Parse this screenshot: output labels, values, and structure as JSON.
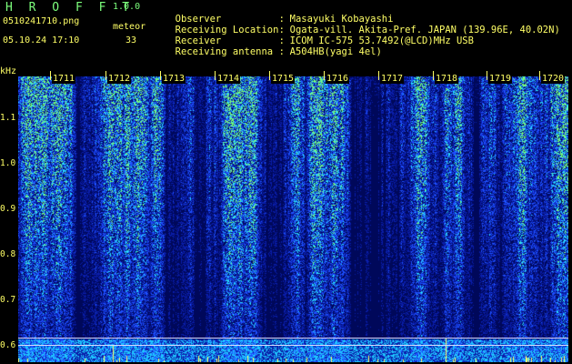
{
  "header": {
    "app_name": "H R O F F T",
    "app_version": "1.0.0",
    "file_name": "0510241710.png",
    "meteor_label": "meteor",
    "datetime": "05.10.24 17:10",
    "meteor_count": "33"
  },
  "info": [
    {
      "key": "Observer",
      "value": "Masayuki Kobayashi"
    },
    {
      "key": "Receiving Location",
      "value": "Ogata-vill. Akita-Pref. JAPAN (139.96E, 40.02N)"
    },
    {
      "key": "Receiver",
      "value": "ICOM IC-575 53.7492(@LCD)MHz USB"
    },
    {
      "key": "Receiving antenna",
      "value": "A504HB(yagi 4el)"
    }
  ],
  "axis": {
    "y_unit": "kHz",
    "y_ticks": [
      "1.1",
      "1.0",
      "0.9",
      "0.8",
      "0.7",
      "0.6"
    ],
    "x_ticks": [
      "1711",
      "1712",
      "1713",
      "1714",
      "1715",
      "1716",
      "1717",
      "1718",
      "1719",
      "1720"
    ]
  },
  "colors": {
    "text": "#ffff66",
    "title": "#7cff7c",
    "noise_dark": "#001a8a",
    "noise_mid": "#1c4cff",
    "noise_bright": "#38e0ff",
    "noise_hot": "#a0ff50"
  }
}
